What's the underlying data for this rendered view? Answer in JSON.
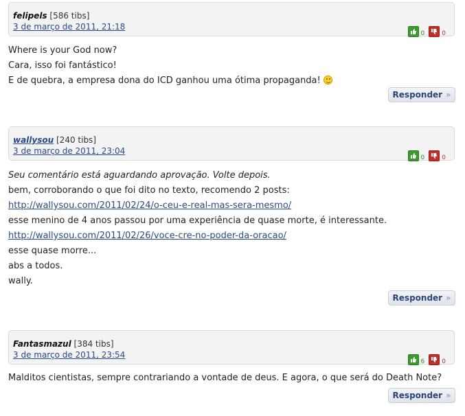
{
  "reply_label": "Responder",
  "reply_chevron": "»",
  "comments": [
    {
      "author": "felipels",
      "tibs": "[586 tibs]",
      "date": "3 de março de 2011, 21:18",
      "up": "0",
      "down": "0",
      "lines": [
        "Where is your God now?",
        "Cara, isso foi fantástico!",
        "E de quebra, a empresa dona do ICD ganhou uma ótima propaganda!"
      ],
      "emoticon": "smiley-icon"
    },
    {
      "author": "wallysou",
      "tibs": "[240 tibs]",
      "date": "3 de março de 2011, 23:04",
      "up": "0",
      "down": "0",
      "pending": "Seu comentário está aguardando aprovação. Volte depois.",
      "lines": [
        "bem, corroborando o que foi dito no texto, recomendo 2 posts:",
        "http://wallysou.com/2011/02/24/o-ceu-e-real-mas-sera-mesmo/",
        "esse menino de 4 anos passou por uma experiência de quase morte, é interessante.",
        "http://wallysou.com/2011/02/26/voce-cre-no-poder-da-oracao/",
        "esse quase morre...",
        "abs a todos.",
        "wally."
      ]
    },
    {
      "author": "Fantasmazul",
      "tibs": "[384 tibs]",
      "date": "3 de março de 2011, 23:54",
      "up": "6",
      "down": "0",
      "lines": [
        "Malditos cientistas, sempre contrariando a vontade de deus. E agora, o que será do Death Note?"
      ]
    }
  ]
}
